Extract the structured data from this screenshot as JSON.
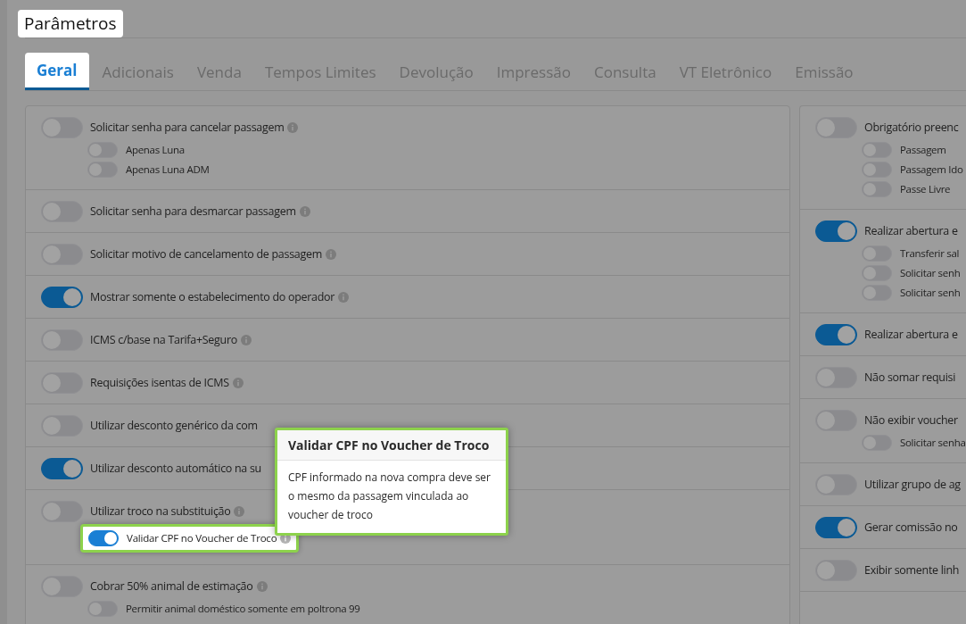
{
  "page": {
    "title": "Parâmetros"
  },
  "tabs": [
    {
      "label": "Geral",
      "selected": true
    },
    {
      "label": "Adicionais",
      "selected": false
    },
    {
      "label": "Venda",
      "selected": false
    },
    {
      "label": "Tempos Limites",
      "selected": false
    },
    {
      "label": "Devolução",
      "selected": false
    },
    {
      "label": "Impressão",
      "selected": false
    },
    {
      "label": "Consulta",
      "selected": false
    },
    {
      "label": "VT Eletrônico",
      "selected": false
    },
    {
      "label": "Emissão",
      "selected": false
    }
  ],
  "columns": [
    {
      "sections": [
        {
          "label": "Solicitar senha para cancelar passagem",
          "on": false,
          "info": true,
          "children": [
            {
              "label": "Apenas Luna",
              "on": false
            },
            {
              "label": "Apenas Luna ADM",
              "on": false
            }
          ]
        },
        {
          "label": "Solicitar senha para desmarcar passagem",
          "on": false,
          "info": true
        },
        {
          "label": "Solicitar motivo de cancelamento de passagem",
          "on": false,
          "info": true
        },
        {
          "label": "Mostrar somente o estabelecimento do operador",
          "on": true,
          "info": true
        },
        {
          "label": "ICMS c/base na Tarifa+Seguro",
          "on": false,
          "info": true
        },
        {
          "label": "Requisições isentas de ICMS",
          "on": false,
          "info": true
        },
        {
          "label": "Utilizar desconto genérico da com",
          "on": false
        },
        {
          "label": "Utilizar desconto automático na su",
          "on": true
        },
        {
          "label": "Utilizar troco na substituição",
          "on": false,
          "info": true,
          "children": [
            {
              "label": "Validar CPF no Voucher de Troco",
              "on": true,
              "info": true,
              "highlighted": true
            }
          ]
        },
        {
          "label": "Cobrar 50% animal de estimação",
          "on": false,
          "info": true,
          "children": [
            {
              "label": "Permitir animal doméstico somente em poltrona 99",
              "on": false
            }
          ]
        }
      ]
    },
    {
      "sections": [
        {
          "label": "Obrigatório preenc",
          "on": false,
          "children": [
            {
              "label": "Passagem",
              "on": false
            },
            {
              "label": "Passagem Ido",
              "on": false
            },
            {
              "label": "Passe Livre",
              "on": false
            }
          ]
        },
        {
          "label": "Realizar abertura e",
          "on": true,
          "children": [
            {
              "label": "Transferir sal",
              "on": false
            },
            {
              "label": "Solicitar senh",
              "on": false
            },
            {
              "label": "Solicitar senh",
              "on": false
            }
          ]
        },
        {
          "label": "Realizar abertura e",
          "on": true
        },
        {
          "label": "Não somar requisi",
          "on": false
        },
        {
          "label": "Não exibir voucher",
          "on": false,
          "children": [
            {
              "label": "Solicitar senha",
              "on": false
            }
          ]
        },
        {
          "label": "Utilizar grupo de ag",
          "on": false
        },
        {
          "label": "Gerar comissão no",
          "on": true
        },
        {
          "label": "Exibir somente linh",
          "on": false
        }
      ]
    }
  ],
  "tooltip": {
    "title": "Validar CPF no Voucher de Troco",
    "text": "CPF informado na nova compra deve ser o mesmo da passagem vinculada ao voucher de troco"
  }
}
